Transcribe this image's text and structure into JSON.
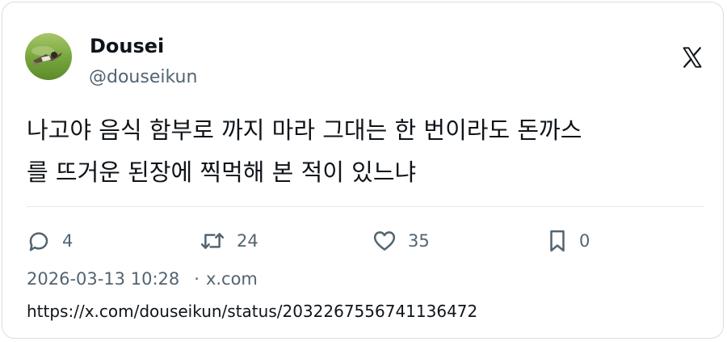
{
  "author": {
    "name": "Dousei",
    "handle": "@douseikun"
  },
  "tweet": {
    "lines": [
      "나고야 음식 함부로 까지 마라 그대는 한 번이라도 돈까스",
      "를 뜨거운 된장에 찍먹해 본 적이 있느냐"
    ]
  },
  "actions": {
    "reply_count": "4",
    "retweet_count": "24",
    "like_count": "35",
    "bookmark_count": "0"
  },
  "meta": {
    "timestamp": "2026-03-13 10:28",
    "separator": "·",
    "source": "x.com"
  },
  "link": {
    "url": "https://x.com/douseikun/status/2032267556741136472"
  },
  "icons": {
    "logo": "x-logo-icon",
    "reply": "speech-bubble-icon",
    "retweet": "retweet-arrows-icon",
    "like": "heart-icon",
    "bookmark": "bookmark-icon"
  },
  "colors": {
    "text_primary": "#0f1419",
    "text_secondary": "#536471",
    "border": "#d9dde1"
  }
}
